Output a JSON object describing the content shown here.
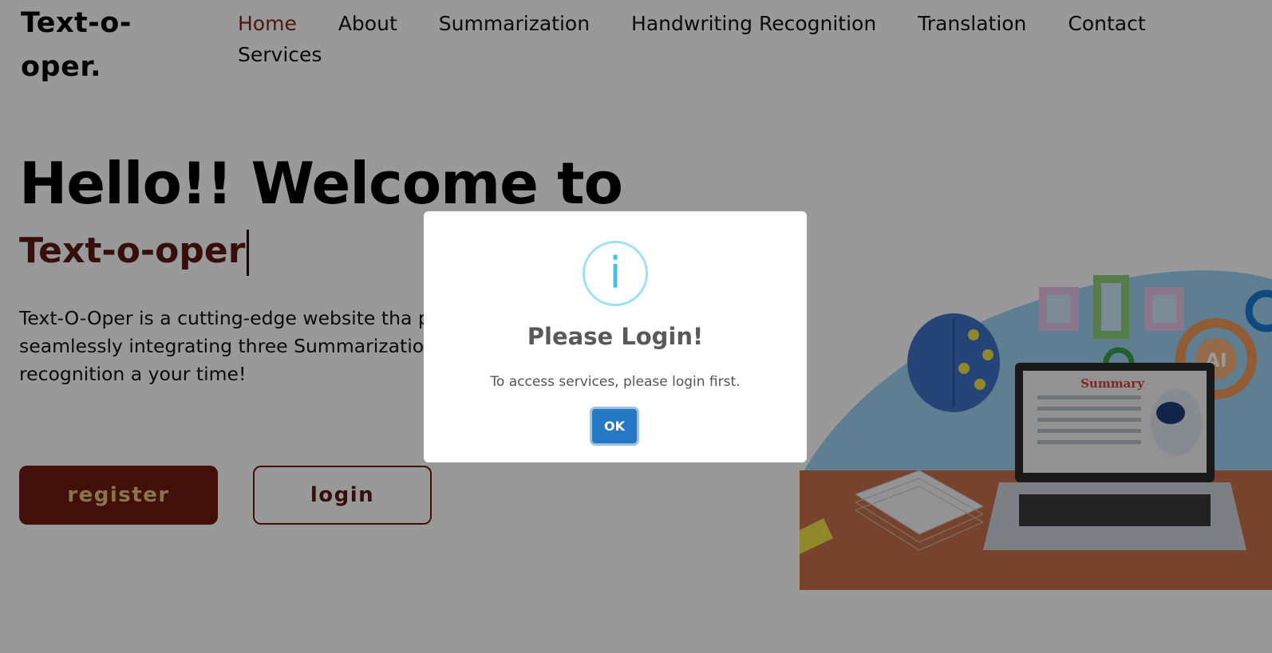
{
  "brand": {
    "logo_text": "Text-o-oper."
  },
  "nav": {
    "home": "Home",
    "about": "About",
    "summarization": "Summarization",
    "handwriting": "Handwriting Recognition",
    "translation": "Translation",
    "contact": "Contact",
    "services": "Services"
  },
  "hero": {
    "title": "Hello!! Welcome to",
    "subtitle": "Text-o-oper",
    "description": "Text-O-Oper is a cutting-edge website tha processing by seamlessly integrating three Summarization, Handwriting recognition a your time!",
    "register_label": "register",
    "login_label": "login"
  },
  "illustration": {
    "summary_label": "Summary",
    "ai_label": "AI"
  },
  "modal": {
    "icon": "info-icon",
    "icon_glyph": "i",
    "title": "Please Login!",
    "text": "To access services, please login first.",
    "ok_label": "OK"
  },
  "colors": {
    "accent": "#7a2a1c",
    "register_bg": "#6e1a12",
    "register_text": "#e6c27a",
    "ok_button": "#2778c4",
    "info_icon": "#3fc3ee"
  }
}
